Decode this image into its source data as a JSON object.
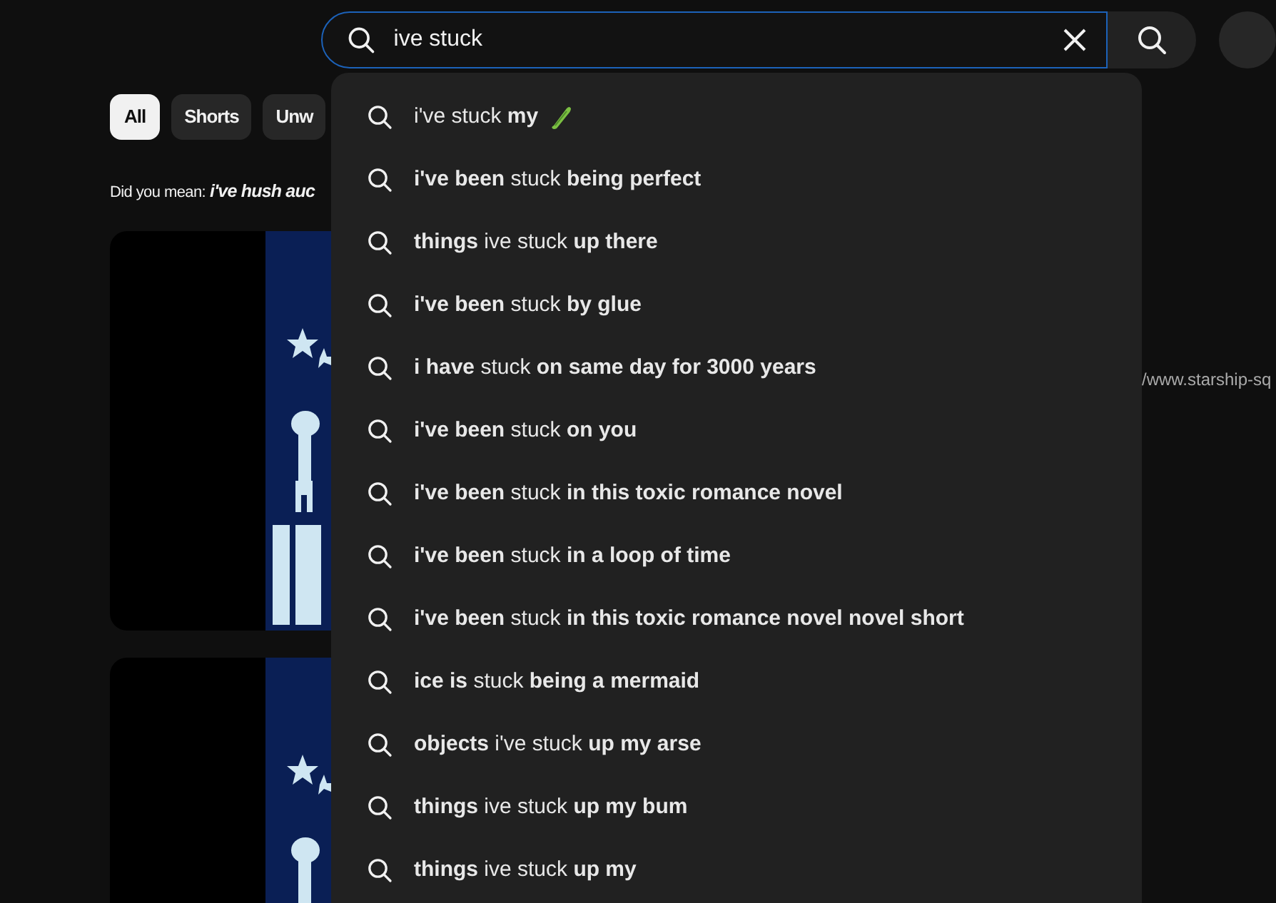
{
  "search": {
    "value": "ive stuck"
  },
  "chips": [
    {
      "label": "All",
      "selected": true
    },
    {
      "label": "Shorts",
      "selected": false
    },
    {
      "label": "Unw",
      "selected": false
    }
  ],
  "did_you_mean": {
    "label": "Did you mean:",
    "suggestion": "i've hush auc"
  },
  "results": [
    {
      "thumbnail": {
        "kind": "picture"
      },
      "link": "/www.starship-sq"
    },
    {
      "thumbnail": {
        "kind": "picture"
      }
    }
  ],
  "suggestions": [
    {
      "kind": "emoji",
      "text": "i've stuck **my**"
    },
    {
      "kind": "plain",
      "text": "**i've been** stuck **being perfect**"
    },
    {
      "kind": "plain",
      "text": "**things** ive stuck **up there**"
    },
    {
      "kind": "plain",
      "text": "**i've been** stuck **by glue**"
    },
    {
      "kind": "plain",
      "text": "**i have** stuck **on same day for 3000 years**"
    },
    {
      "kind": "plain",
      "text": "**i've been** stuck **on you**"
    },
    {
      "kind": "plain",
      "text": "**i've been** stuck **in this toxic romance novel**"
    },
    {
      "kind": "plain",
      "text": "**i've been** stuck **in a loop of time**"
    },
    {
      "kind": "plain",
      "text": "**i've been** stuck **in this toxic romance novel novel short**"
    },
    {
      "kind": "plain",
      "text": "**ice is** stuck **being a mermaid**"
    },
    {
      "kind": "plain",
      "text": "**objects** i've stuck **up my arse**"
    },
    {
      "kind": "plain",
      "text": "**things** ive stuck **up my bum**"
    },
    {
      "kind": "plain",
      "text": "**things** ive stuck **up my**"
    }
  ]
}
